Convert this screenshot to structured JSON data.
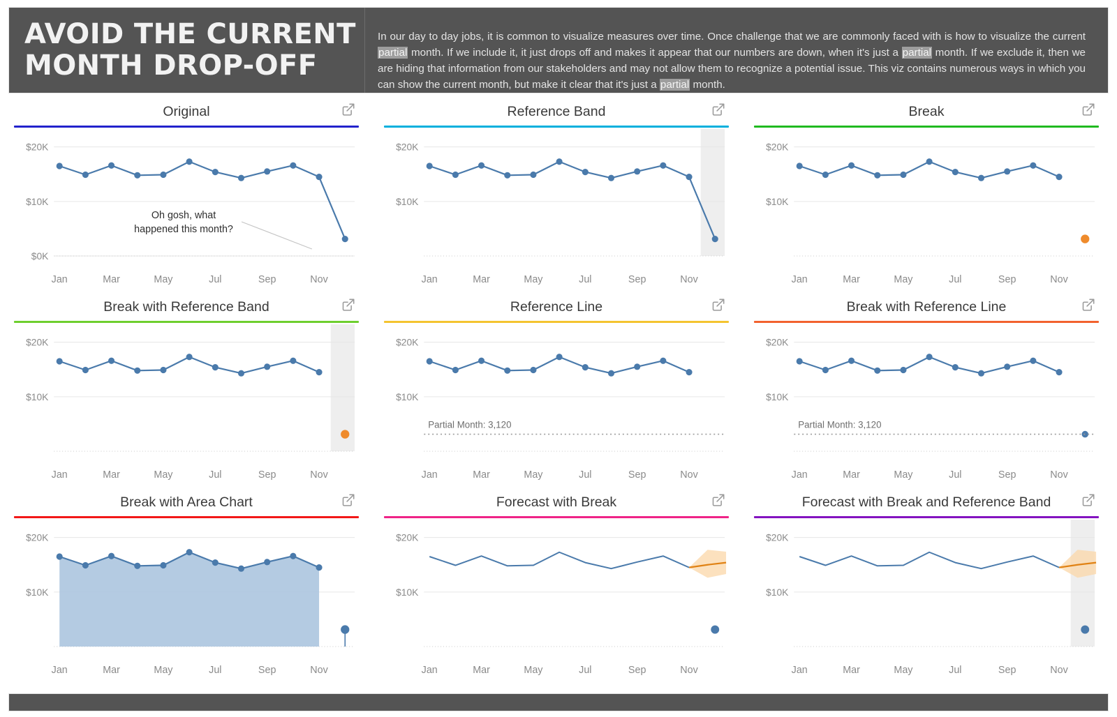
{
  "header": {
    "title": "AVOID THE CURRENT MONTH DROP-OFF",
    "body_parts": [
      {
        "t": "In our day to day jobs, it is common to visualize measures over time. Once challenge that we are commonly faced with is how to visualize the current ",
        "hl": false
      },
      {
        "t": "partial",
        "hl": true
      },
      {
        "t": " month. If we include it, it just drops off and makes it appear that our numbers are down, when it's just a ",
        "hl": false
      },
      {
        "t": "partial",
        "hl": true
      },
      {
        "t": " month. If we exclude it, then we are hiding that information from our stakeholders and may not allow them to recognize a potential issue. This viz contains numerous ways in which you can show the current month, but make it clear that it's just a ",
        "hl": false
      },
      {
        "t": "partial",
        "hl": true
      },
      {
        "t": " month.",
        "hl": false
      }
    ],
    "bg_color": "#545454",
    "text_color": "#e4e4e4",
    "highlight_color": "#9e9e9e"
  },
  "icons": {
    "external_link": "external-link-icon"
  },
  "colors": {
    "line": "#4a7aab",
    "marker": "#4a7aab",
    "orange_marker": "#ef8b2c",
    "area_fill": "#aec7e0",
    "forecast_line": "#e08214",
    "forecast_band": "#fbd7a8",
    "band_fill": "#eeeeee",
    "gridline": "#e6e6e6",
    "axis_text": "#8a8a8a",
    "title_text": "#3a3a3a"
  },
  "axis": {
    "y_ticks_full": [
      "$20K",
      "$10K",
      "$0K"
    ],
    "y_ticks": [
      "$20K",
      "$10K"
    ],
    "x_ticks": [
      "Jan",
      "Mar",
      "May",
      "Jul",
      "Sep",
      "Nov"
    ]
  },
  "chart_data": [
    {
      "id": "original",
      "type": "line",
      "title": "Original",
      "accent_color": "#2222cc",
      "categories": [
        "Jan",
        "Feb",
        "Mar",
        "Apr",
        "May",
        "Jun",
        "Jul",
        "Aug",
        "Sep",
        "Oct",
        "Nov",
        "Dec"
      ],
      "values": [
        16500,
        14900,
        16600,
        14800,
        14900,
        17300,
        15400,
        14300,
        15500,
        16600,
        14500,
        3120
      ],
      "ylabel": "",
      "xlabel": "",
      "ylim": [
        0,
        22000
      ],
      "y_ticks": [
        20000,
        10000,
        0
      ],
      "y_tick_labels": [
        "$20K",
        "$10K",
        "$0K"
      ],
      "x_tick_labels": [
        "Jan",
        "Mar",
        "May",
        "Jul",
        "Sep",
        "Nov"
      ],
      "grid": true,
      "markers": true,
      "annotation": "Oh gosh, what happened this month?",
      "annotation_line_1": "Oh gosh, what",
      "annotation_line_2": "happened this month?",
      "partial_month_highlight": false,
      "legend": "none"
    },
    {
      "id": "reference-band",
      "type": "line",
      "title": "Reference Band",
      "accent_color": "#00b0dd",
      "categories": [
        "Jan",
        "Feb",
        "Mar",
        "Apr",
        "May",
        "Jun",
        "Jul",
        "Aug",
        "Sep",
        "Oct",
        "Nov",
        "Dec"
      ],
      "values": [
        16500,
        14900,
        16600,
        14800,
        14900,
        17300,
        15400,
        14300,
        15500,
        16600,
        14500,
        3120
      ],
      "ylim": [
        0,
        22000
      ],
      "y_ticks": [
        20000,
        10000
      ],
      "y_tick_labels": [
        "$20K",
        "$10K"
      ],
      "x_tick_labels": [
        "Jan",
        "Mar",
        "May",
        "Jul",
        "Sep",
        "Nov"
      ],
      "grid": true,
      "markers": true,
      "partial_month_highlight": true,
      "legend": "none"
    },
    {
      "id": "break",
      "type": "line",
      "title": "Break",
      "accent_color": "#1fba1f",
      "categories": [
        "Jan",
        "Feb",
        "Mar",
        "Apr",
        "May",
        "Jun",
        "Jul",
        "Aug",
        "Sep",
        "Oct",
        "Nov",
        "Dec"
      ],
      "values": [
        16500,
        14900,
        16600,
        14800,
        14900,
        17300,
        15400,
        14300,
        15500,
        16600,
        14500,
        3120
      ],
      "break_after": "Nov",
      "last_point_color": "#ef8b2c",
      "ylim": [
        0,
        22000
      ],
      "y_ticks": [
        20000,
        10000
      ],
      "y_tick_labels": [
        "$20K",
        "$10K"
      ],
      "x_tick_labels": [
        "Jan",
        "Mar",
        "May",
        "Jul",
        "Sep",
        "Nov"
      ],
      "grid": true,
      "markers": true,
      "partial_month_highlight": false,
      "legend": "none"
    },
    {
      "id": "break-with-reference-band",
      "type": "line",
      "title": "Break with Reference Band",
      "accent_color": "#6ecf2e",
      "categories": [
        "Jan",
        "Feb",
        "Mar",
        "Apr",
        "May",
        "Jun",
        "Jul",
        "Aug",
        "Sep",
        "Oct",
        "Nov",
        "Dec"
      ],
      "values": [
        16500,
        14900,
        16600,
        14800,
        14900,
        17300,
        15400,
        14300,
        15500,
        16600,
        14500,
        3120
      ],
      "break_after": "Nov",
      "last_point_color": "#ef8b2c",
      "ylim": [
        0,
        22000
      ],
      "y_ticks": [
        20000,
        10000
      ],
      "y_tick_labels": [
        "$20K",
        "$10K"
      ],
      "x_tick_labels": [
        "Jan",
        "Mar",
        "May",
        "Jul",
        "Sep",
        "Nov"
      ],
      "grid": true,
      "markers": true,
      "partial_month_highlight": true,
      "legend": "none"
    },
    {
      "id": "reference-line",
      "type": "line",
      "title": "Reference Line",
      "accent_color": "#f4c430",
      "categories": [
        "Jan",
        "Feb",
        "Mar",
        "Apr",
        "May",
        "Jun",
        "Jul",
        "Aug",
        "Sep",
        "Oct",
        "Nov"
      ],
      "values": [
        16500,
        14900,
        16600,
        14800,
        14900,
        17300,
        15400,
        14300,
        15500,
        16600,
        14500
      ],
      "reference_line": {
        "label": "Partial Month: 3,120",
        "value": 3120,
        "style": "dotted"
      },
      "ylim": [
        0,
        22000
      ],
      "y_ticks": [
        20000,
        10000
      ],
      "y_tick_labels": [
        "$20K",
        "$10K"
      ],
      "x_tick_labels": [
        "Jan",
        "Mar",
        "May",
        "Jul",
        "Sep",
        "Nov"
      ],
      "grid": true,
      "markers": true,
      "partial_month_highlight": false,
      "legend": "none"
    },
    {
      "id": "break-with-reference-line",
      "type": "line",
      "title": "Break with Reference Line",
      "accent_color": "#f2622e",
      "categories": [
        "Jan",
        "Feb",
        "Mar",
        "Apr",
        "May",
        "Jun",
        "Jul",
        "Aug",
        "Sep",
        "Oct",
        "Nov",
        "Dec"
      ],
      "values": [
        16500,
        14900,
        16600,
        14800,
        14900,
        17300,
        15400,
        14300,
        15500,
        16600,
        14500,
        3120
      ],
      "break_after": "Nov",
      "last_point_color": "#4a7aab",
      "reference_line": {
        "label": "Partial Month: 3,120",
        "value": 3120,
        "style": "dotted"
      },
      "ylim": [
        0,
        22000
      ],
      "y_ticks": [
        20000,
        10000
      ],
      "y_tick_labels": [
        "$20K",
        "$10K"
      ],
      "x_tick_labels": [
        "Jan",
        "Mar",
        "May",
        "Jul",
        "Sep",
        "Nov"
      ],
      "grid": true,
      "markers": true,
      "partial_month_highlight": false,
      "legend": "none"
    },
    {
      "id": "break-with-area-chart",
      "type": "area",
      "title": "Break with Area Chart",
      "accent_color": "#f21818",
      "categories": [
        "Jan",
        "Feb",
        "Mar",
        "Apr",
        "May",
        "Jun",
        "Jul",
        "Aug",
        "Sep",
        "Oct",
        "Nov",
        "Dec"
      ],
      "values": [
        16500,
        14900,
        16600,
        14800,
        14900,
        17300,
        15400,
        14300,
        15500,
        16600,
        14500,
        3120
      ],
      "break_after": "Nov",
      "last_point_color": "#4a7aab",
      "ylim": [
        0,
        22000
      ],
      "y_ticks": [
        20000,
        10000
      ],
      "y_tick_labels": [
        "$20K",
        "$10K"
      ],
      "x_tick_labels": [
        "Jan",
        "Mar",
        "May",
        "Jul",
        "Sep",
        "Nov"
      ],
      "grid": true,
      "markers": true,
      "partial_month_highlight": false,
      "legend": "none"
    },
    {
      "id": "forecast-with-break",
      "type": "line",
      "title": "Forecast with Break",
      "accent_color": "#ef2387",
      "categories": [
        "Jan",
        "Feb",
        "Mar",
        "Apr",
        "May",
        "Jun",
        "Jul",
        "Aug",
        "Sep",
        "Oct",
        "Nov",
        "Dec"
      ],
      "values": [
        16500,
        14900,
        16600,
        14800,
        14900,
        17300,
        15400,
        14300,
        15500,
        16600,
        14500,
        3120
      ],
      "break_after": "Nov",
      "last_point_color": "#4a7aab",
      "forecast": {
        "values": [
          14500,
          15400
        ],
        "upper": [
          14500,
          17400
        ],
        "lower": [
          14500,
          13300
        ],
        "color": "#e08214",
        "band_color": "#fbd7a8"
      },
      "ylim": [
        0,
        22000
      ],
      "y_ticks": [
        20000,
        10000
      ],
      "y_tick_labels": [
        "$20K",
        "$10K"
      ],
      "x_tick_labels": [
        "Jan",
        "Mar",
        "May",
        "Jul",
        "Sep",
        "Nov"
      ],
      "grid": true,
      "markers": false,
      "partial_month_highlight": false,
      "legend": "none"
    },
    {
      "id": "forecast-with-break-and-reference-band",
      "type": "line",
      "title": "Forecast with Break and Reference Band",
      "accent_color": "#8313c0",
      "categories": [
        "Jan",
        "Feb",
        "Mar",
        "Apr",
        "May",
        "Jun",
        "Jul",
        "Aug",
        "Sep",
        "Oct",
        "Nov",
        "Dec"
      ],
      "values": [
        16500,
        14900,
        16600,
        14800,
        14900,
        17300,
        15400,
        14300,
        15500,
        16600,
        14500,
        3120
      ],
      "break_after": "Nov",
      "last_point_color": "#4a7aab",
      "forecast": {
        "values": [
          14500,
          15400
        ],
        "upper": [
          14500,
          17400
        ],
        "lower": [
          14500,
          13300
        ],
        "color": "#e08214",
        "band_color": "#fbd7a8"
      },
      "ylim": [
        0,
        22000
      ],
      "y_ticks": [
        20000,
        10000
      ],
      "y_tick_labels": [
        "$20K",
        "$10K"
      ],
      "x_tick_labels": [
        "Jan",
        "Mar",
        "May",
        "Jul",
        "Sep",
        "Nov"
      ],
      "grid": true,
      "markers": false,
      "partial_month_highlight": true,
      "legend": "none"
    }
  ]
}
